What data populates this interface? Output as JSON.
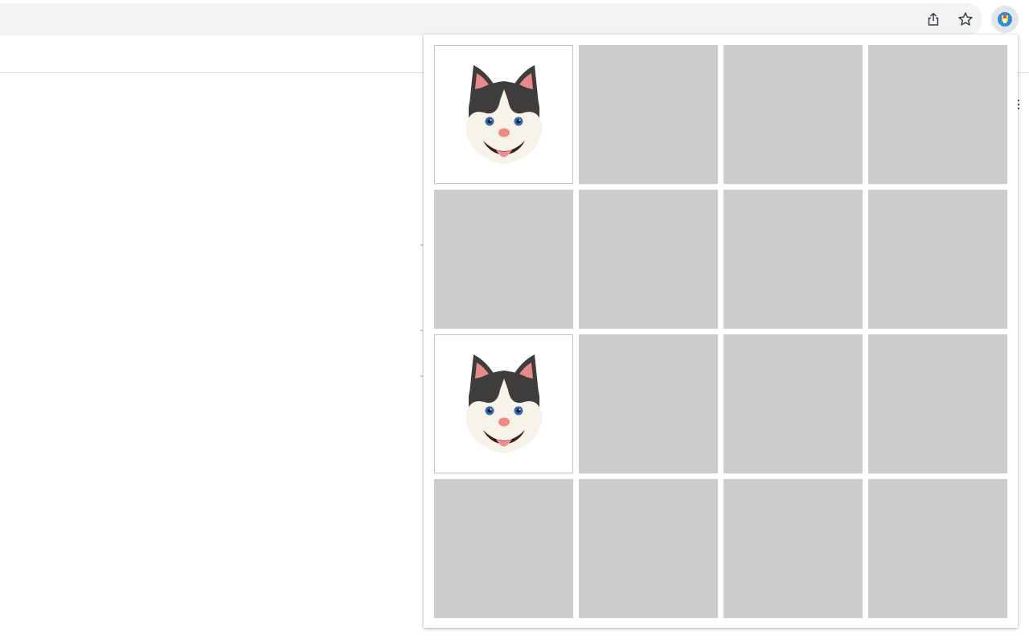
{
  "toolbar": {
    "share_icon": "share-icon",
    "bookmark_icon": "star-icon",
    "extension_icon": "memory-game-extension-icon"
  },
  "game": {
    "rows": 4,
    "columns": 4,
    "cards": [
      {
        "state": "revealed",
        "image": "husky-face"
      },
      {
        "state": "hidden"
      },
      {
        "state": "hidden"
      },
      {
        "state": "hidden"
      },
      {
        "state": "hidden"
      },
      {
        "state": "hidden"
      },
      {
        "state": "hidden"
      },
      {
        "state": "hidden"
      },
      {
        "state": "revealed",
        "image": "husky-face"
      },
      {
        "state": "hidden"
      },
      {
        "state": "hidden"
      },
      {
        "state": "hidden"
      },
      {
        "state": "hidden"
      },
      {
        "state": "hidden"
      },
      {
        "state": "hidden"
      },
      {
        "state": "hidden"
      }
    ],
    "colors": {
      "hidden_card": "#cccccc",
      "revealed_card": "#ffffff",
      "husky_fur": "#3f3d3b",
      "husky_face": "#f8f3e8",
      "husky_ear_inner": "#e88a8a",
      "husky_eye": "#2f6db5",
      "husky_nose": "#ef8a82",
      "husky_tongue": "#f08f92"
    }
  }
}
